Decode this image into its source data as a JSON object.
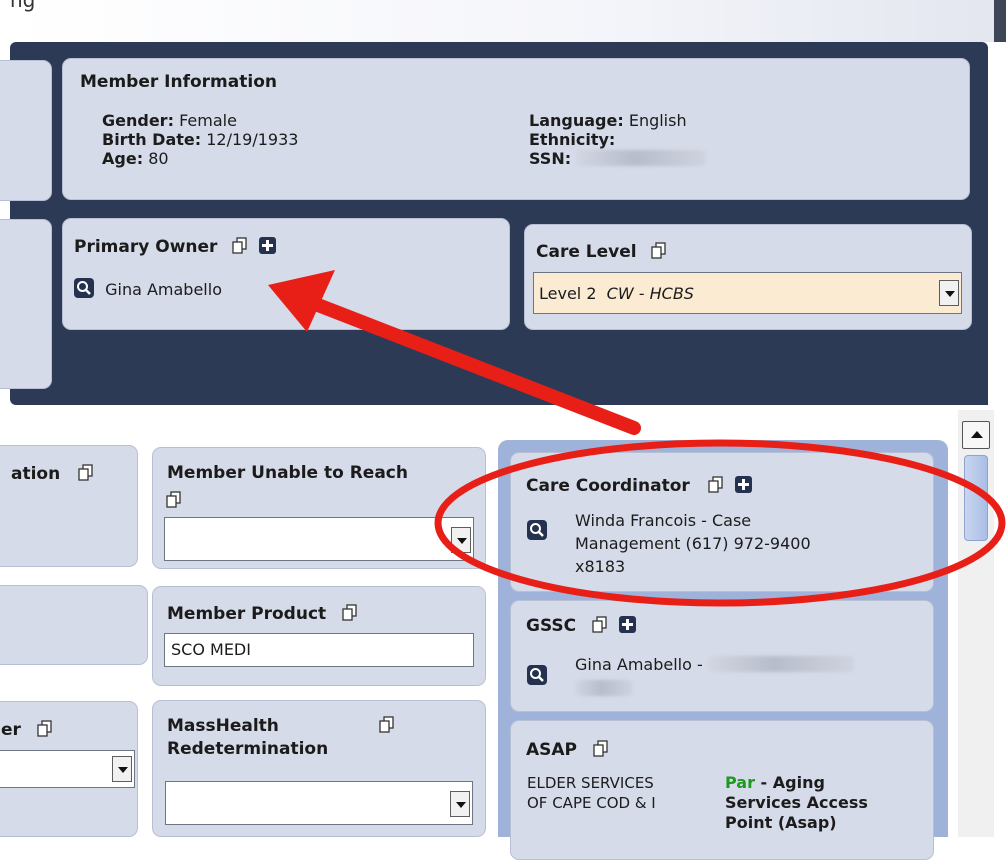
{
  "top_cropped_text": "ng",
  "member_information": {
    "title": "Member Information",
    "gender_label": "Gender:",
    "gender_value": "Female",
    "birth_date_label": "Birth Date:",
    "birth_date_value": "12/19/1933",
    "age_label": "Age:",
    "age_value": "80",
    "language_label": "Language:",
    "language_value": "English",
    "ethnicity_label": "Ethnicity:",
    "ethnicity_value": "",
    "ssn_label": "SSN:"
  },
  "primary_owner": {
    "title": "Primary Owner",
    "name": "Gina Amabello"
  },
  "care_level": {
    "title": "Care Level",
    "value_plain": "Level 2",
    "value_italic": "CW - HCBS"
  },
  "left_panels": {
    "cropped_title_1": "ation",
    "cropped_title_2": "er"
  },
  "member_unable_to_reach": {
    "title": "Member Unable to Reach",
    "selected": ""
  },
  "member_product": {
    "title": "Member Product",
    "value": "SCO MEDI"
  },
  "masshealth_redetermination": {
    "title_line1": "MassHealth",
    "title_line2": "Redetermination",
    "selected": ""
  },
  "care_coordinator": {
    "title": "Care Coordinator",
    "line1": "Winda Francois - Case",
    "line2": "Management (617) 972-9400",
    "line3": "x8183"
  },
  "gssc": {
    "title": "GSSC",
    "name": "Gina Amabello -"
  },
  "asap": {
    "title": "ASAP",
    "org_line1": "ELDER SERVICES",
    "org_line2": "OF CAPE COD & I",
    "par": "Par",
    "desc_line1": " - Aging",
    "desc_line2": "Services Access",
    "desc_line3": "Point (Asap)"
  },
  "colors": {
    "header_bg": "#2d3a55",
    "card_bg": "#d6dbe9",
    "care_level_field": "#faebd2",
    "annotation_red": "#e81f17",
    "par_green": "#1d9a1d"
  }
}
